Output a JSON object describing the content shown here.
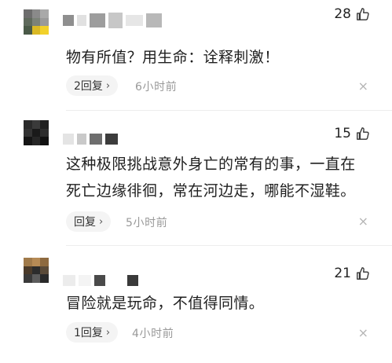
{
  "comments": [
    {
      "likes": "28",
      "text_lines": [
        "物有所值？用生命：诠释刺激！"
      ],
      "reply_label": "2回复",
      "chevron": "›",
      "time": "6小时前",
      "close": "×"
    },
    {
      "likes": "15",
      "text_lines": [
        "这种极限挑战意外身亡的常有的事，一直在",
        "死亡边缘徘徊，常在河边走，哪能不湿鞋。"
      ],
      "reply_label": "回复",
      "chevron": "›",
      "time": "5小时前",
      "close": "×"
    },
    {
      "likes": "21",
      "text_lines": [
        "冒险就是玩命，不值得同情。"
      ],
      "reply_label": "1回复",
      "chevron": "›",
      "time": "4小时前",
      "close": "×"
    }
  ],
  "colors": {
    "text": "#1f1f1f",
    "time": "#999999",
    "pill_bg": "#f4f4f4",
    "close": "#b5b5b5"
  },
  "icons": {
    "like": "thumbs-up-icon",
    "close": "close-icon",
    "reply": "chevron-right-icon"
  }
}
